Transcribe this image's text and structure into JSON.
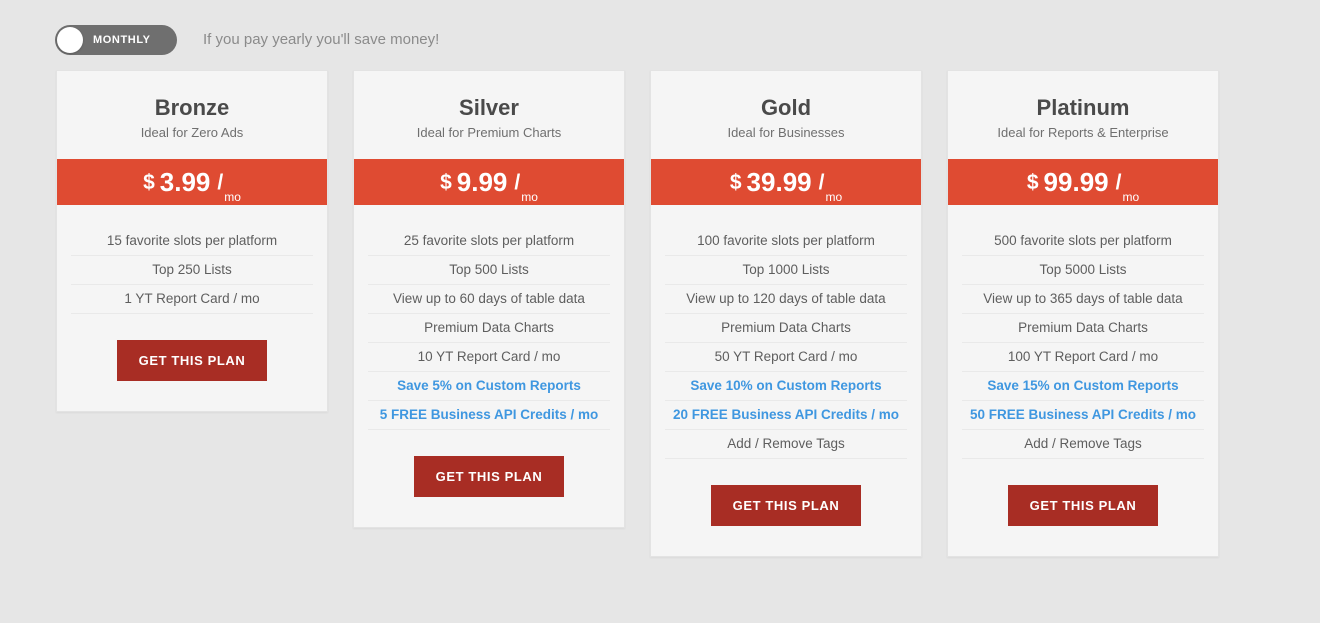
{
  "billing_toggle": {
    "state_label": "MONTHLY",
    "knob_position": "left"
  },
  "tagline": "If you pay yearly you'll save money!",
  "colors": {
    "page_background": "#e6e6e6",
    "card_background": "#f5f5f5",
    "price_banner": "#df4b32",
    "cta_button": "#a82d24",
    "highlight_link": "#3f97e0",
    "toggle_track": "#6f6f6f",
    "body_text": "#5e5e5e"
  },
  "cta_label": "GET THIS PLAN",
  "plans": [
    {
      "name": "Bronze",
      "subtitle": "Ideal for Zero Ads",
      "currency": "$",
      "amount": "3.99",
      "per": "/",
      "unit": "mo",
      "features": [
        {
          "text": "15 favorite slots per platform",
          "highlight": false
        },
        {
          "text": "Top 250 Lists",
          "highlight": false
        },
        {
          "text": "1 YT Report Card / mo",
          "highlight": false
        }
      ],
      "cta": "GET THIS PLAN"
    },
    {
      "name": "Silver",
      "subtitle": "Ideal for Premium Charts",
      "currency": "$",
      "amount": "9.99",
      "per": "/",
      "unit": "mo",
      "features": [
        {
          "text": "25 favorite slots per platform",
          "highlight": false
        },
        {
          "text": "Top 500 Lists",
          "highlight": false
        },
        {
          "text": "View up to 60 days of table data",
          "highlight": false
        },
        {
          "text": "Premium Data Charts",
          "highlight": false
        },
        {
          "text": "10 YT Report Card / mo",
          "highlight": false
        },
        {
          "text": "Save 5% on Custom Reports",
          "highlight": true
        },
        {
          "text": "5 FREE Business API Credits / mo",
          "highlight": true
        }
      ],
      "cta": "GET THIS PLAN"
    },
    {
      "name": "Gold",
      "subtitle": "Ideal for Businesses",
      "currency": "$",
      "amount": "39.99",
      "per": "/",
      "unit": "mo",
      "features": [
        {
          "text": "100 favorite slots per platform",
          "highlight": false
        },
        {
          "text": "Top 1000 Lists",
          "highlight": false
        },
        {
          "text": "View up to 120 days of table data",
          "highlight": false
        },
        {
          "text": "Premium Data Charts",
          "highlight": false
        },
        {
          "text": "50 YT Report Card / mo",
          "highlight": false
        },
        {
          "text": "Save 10% on Custom Reports",
          "highlight": true
        },
        {
          "text": "20 FREE Business API Credits / mo",
          "highlight": true
        },
        {
          "text": "Add / Remove Tags",
          "highlight": false
        }
      ],
      "cta": "GET THIS PLAN"
    },
    {
      "name": "Platinum",
      "subtitle": "Ideal for Reports & Enterprise",
      "currency": "$",
      "amount": "99.99",
      "per": "/",
      "unit": "mo",
      "features": [
        {
          "text": "500 favorite slots per platform",
          "highlight": false
        },
        {
          "text": "Top 5000 Lists",
          "highlight": false
        },
        {
          "text": "View up to 365 days of table data",
          "highlight": false
        },
        {
          "text": "Premium Data Charts",
          "highlight": false
        },
        {
          "text": "100 YT Report Card / mo",
          "highlight": false
        },
        {
          "text": "Save 15% on Custom Reports",
          "highlight": true
        },
        {
          "text": "50 FREE Business API Credits / mo",
          "highlight": true
        },
        {
          "text": "Add / Remove Tags",
          "highlight": false
        }
      ],
      "cta": "GET THIS PLAN"
    }
  ]
}
